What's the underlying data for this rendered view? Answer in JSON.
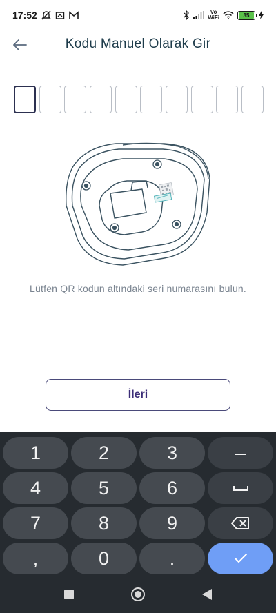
{
  "status_bar": {
    "time": "17:52",
    "volte_line1": "Vo",
    "volte_line2": "WiFi",
    "battery_level": "35"
  },
  "header": {
    "title": "Kodu Manuel Olarak Gir"
  },
  "code_input": {
    "box_count": 10,
    "active_index": 0
  },
  "hint_text": "Lütfen QR kodun altındaki seri numarasını bulun.",
  "next_button": {
    "label": "İleri"
  },
  "keyboard": {
    "keys": [
      "1",
      "2",
      "3",
      "–",
      "4",
      "5",
      "6",
      "space-icon",
      "7",
      "8",
      "9",
      "backspace-icon",
      ",",
      "0",
      ".",
      "check-icon"
    ],
    "labels": {
      "k1": "1",
      "k2": "2",
      "k3": "3",
      "minus": "–",
      "k4": "4",
      "k5": "5",
      "k6": "6",
      "k7": "7",
      "k8": "8",
      "k9": "9",
      "comma": ",",
      "k0": "0",
      "period": "."
    }
  },
  "colors": {
    "title": "#1d3b4a",
    "accent_purple": "#3c2e78",
    "keyboard_bg": "#262b30",
    "key_bg": "#454a50",
    "done_key": "#6f9ef6"
  }
}
